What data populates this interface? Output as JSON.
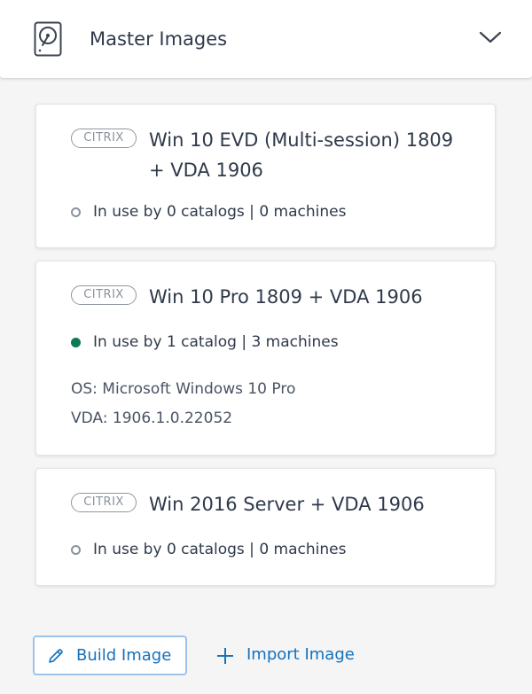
{
  "header": {
    "title": "Master Images",
    "icon": "hard-disk-icon",
    "toggle_icon": "chevron-down-icon"
  },
  "images": [
    {
      "vendor": "CITRIX",
      "title_line1": "Win 10 EVD (Multi-session) 1809",
      "title_line2": "+ VDA 1906",
      "status": "In use by 0 catalogs | 0 machines",
      "in_use": false
    },
    {
      "vendor": "CITRIX",
      "title_line1": "Win 10 Pro 1809 + VDA 1906",
      "status": "In use by 1 catalog | 3 machines",
      "in_use": true,
      "os": "OS: Microsoft Windows 10 Pro",
      "vda": "VDA: 1906.1.0.22052"
    },
    {
      "vendor": "CITRIX",
      "title_line1": "Win 2016 Server + VDA 1906",
      "status": "In use by 0 catalogs | 0 machines",
      "in_use": false
    }
  ],
  "actions": {
    "build_label": "Build Image",
    "import_label": "Import Image"
  },
  "colors": {
    "accent": "#1572bd",
    "active_status": "#0c7a55",
    "idle_status": "#8a929e",
    "background": "#f5f5f5"
  }
}
